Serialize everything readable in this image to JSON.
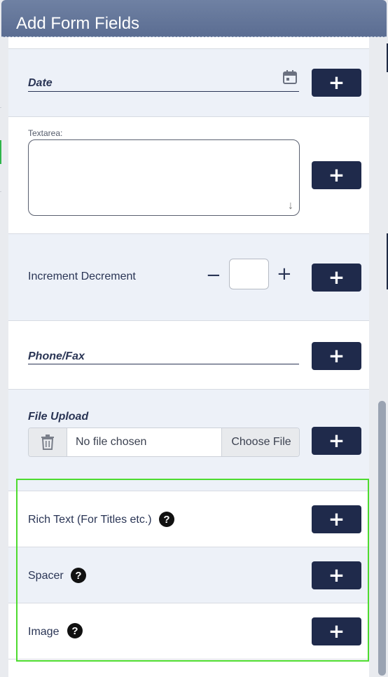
{
  "modal": {
    "title": "Add Form Fields"
  },
  "fields": {
    "date": {
      "label": "Date",
      "add_label": "+"
    },
    "textarea": {
      "label": "Textarea:",
      "add_label": "+"
    },
    "increment": {
      "label": "Increment Decrement",
      "minus": "−",
      "plus": "+",
      "value": "",
      "add_label": "+"
    },
    "phone": {
      "label": "Phone/Fax",
      "add_label": "+"
    },
    "file_upload": {
      "label": "File Upload",
      "status": "No file chosen",
      "choose_label": "Choose File",
      "add_label": "+"
    },
    "rich_text": {
      "label": "Rich Text (For Titles etc.)",
      "add_label": "+"
    },
    "spacer": {
      "label": "Spacer",
      "add_label": "+"
    },
    "image": {
      "label": "Image",
      "add_label": "+"
    }
  },
  "icons": {
    "date": "calendar-icon",
    "help": "question-circle-icon",
    "trash": "trash-icon",
    "resize": "resize-handle-icon"
  },
  "colors": {
    "header": "#5f7196",
    "button": "#1f2a4b",
    "row_shade": "#edf1f8",
    "highlight": "#4ddb2f"
  }
}
